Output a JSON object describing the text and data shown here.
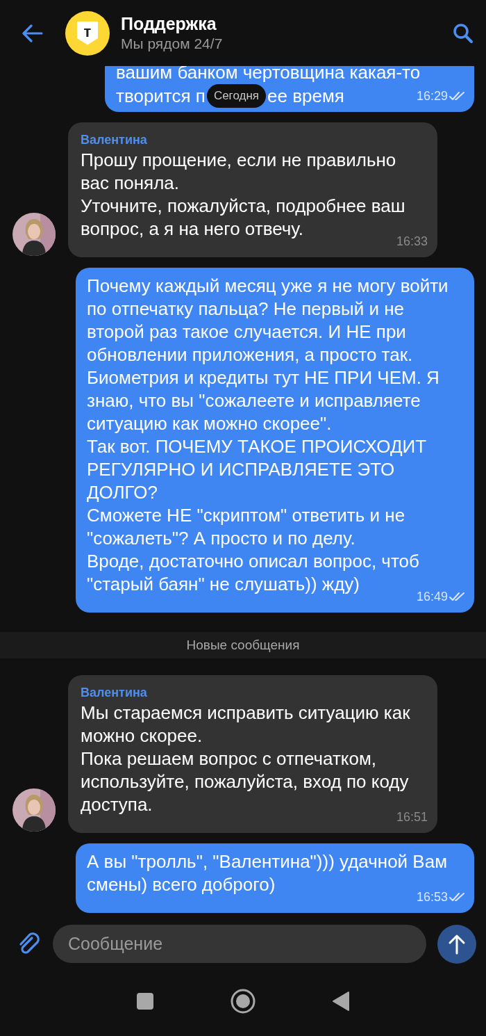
{
  "header": {
    "logo_letter": "т",
    "title": "Поддержка",
    "subtitle": "Мы рядом 24/7"
  },
  "date_chip": "Сегодня",
  "messages": [
    {
      "kind": "outgoing_fragment",
      "lines": [
        [
          "вашим банком чертовщина какая-то"
        ],
        [
          "творится п",
          "ее время"
        ]
      ],
      "time": "16:29",
      "read": true
    },
    {
      "kind": "incoming",
      "sender": "Валентина",
      "text": "Прошу прощение, если не правильно вас поняла.\nУточните, пожалуйста, подробнее ваш вопрос, а я на него отвечу.",
      "time": "16:33"
    },
    {
      "kind": "outgoing",
      "text": "Почему каждый месяц уже я не могу войти по отпечатку пальца? Не первый и не второй раз такое случается. И НЕ при обновлении приложения, а просто так. Биометрия и кредиты тут НЕ ПРИ ЧЕМ. Я знаю, что вы \"сожалеете и исправляете ситуацию как можно скорее\".\nТак вот. ПОЧЕМУ ТАКОЕ ПРОИСХОДИТ РЕГУЛЯРНО И ИСПРАВЛЯЕТЕ ЭТО ДОЛГО?\nСможете НЕ \"скриптом\" ответить и не \"сожалеть\"? А просто и по делу.\nВроде, достаточно описал вопрос, чтоб \"старый баян\" не слушать)) жду)",
      "time": "16:49",
      "read": true
    },
    {
      "kind": "divider",
      "text": "Новые сообщения"
    },
    {
      "kind": "incoming",
      "sender": "Валентина",
      "text": "Мы стараемся исправить ситуацию как можно скорее.\nПока решаем вопрос с отпечатком, используйте, пожалуйста, вход по коду доступа.",
      "time": "16:51"
    },
    {
      "kind": "outgoing",
      "text": "А вы \"тролль\", \"Валентина\"))) удачной Вам смены) всего доброго)",
      "time": "16:53",
      "read": true
    }
  ],
  "composer": {
    "placeholder": "Сообщение"
  }
}
